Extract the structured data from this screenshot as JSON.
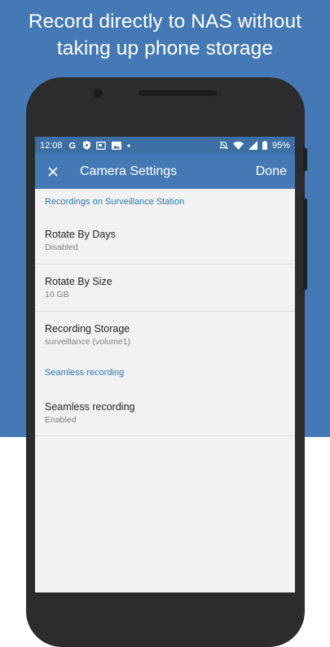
{
  "promo": {
    "headline_line1": "Record directly to NAS without",
    "headline_line2": "taking up phone storage",
    "background_color": "#4579b5"
  },
  "status_bar": {
    "time": "12:08",
    "battery": "95%",
    "icons_left": [
      "google-icon",
      "shield-icon",
      "cast-icon",
      "image-icon",
      "dot-icon"
    ],
    "icons_right": [
      "alarm-off-icon",
      "wifi-icon",
      "signal-icon",
      "battery-icon"
    ]
  },
  "app_bar": {
    "title": "Camera Settings",
    "done_label": "Done",
    "close_icon": "close-icon"
  },
  "sections": [
    {
      "header": "Recordings on Surveillance Station",
      "items": [
        {
          "title": "Rotate By Days",
          "subtitle": "Disabled"
        },
        {
          "title": "Rotate By Size",
          "subtitle": "10 GB"
        },
        {
          "title": "Recording Storage",
          "subtitle": "surveillance (volume1)"
        }
      ]
    },
    {
      "header": "Seamless recording",
      "items": [
        {
          "title": "Seamless recording",
          "subtitle": "Enabled"
        }
      ]
    }
  ],
  "colors": {
    "accent": "#2a78b3",
    "app_bar": "#4579b5",
    "status_bar": "#3d6ea4",
    "screen_bg": "#f2f2f2"
  }
}
